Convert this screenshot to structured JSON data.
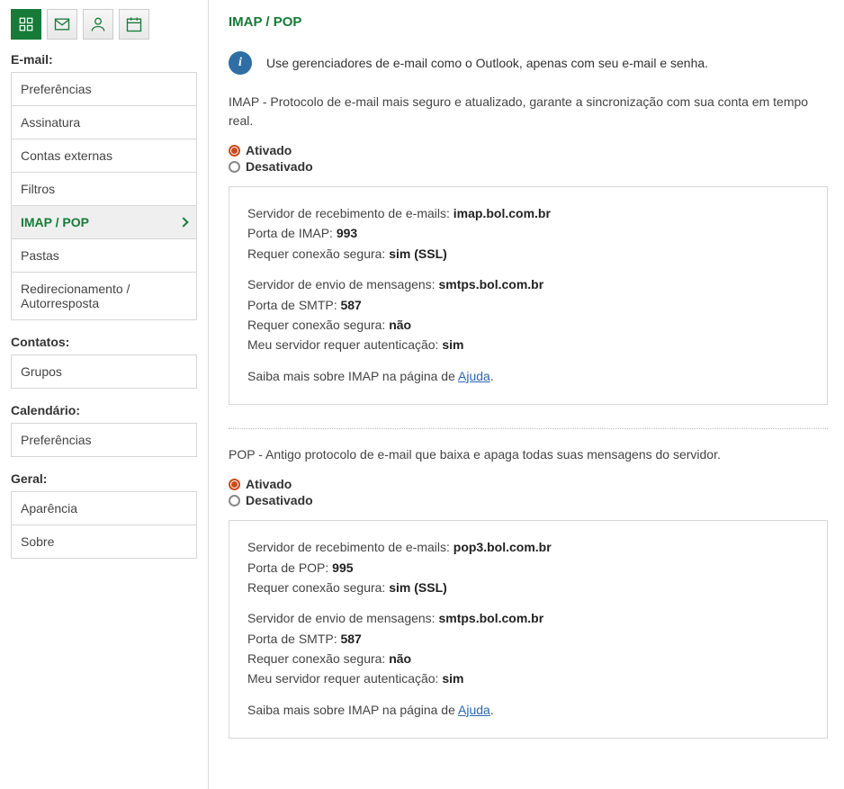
{
  "sidebar": {
    "sections": [
      {
        "title": "E-mail:",
        "items": [
          {
            "label": "Preferências",
            "selected": false
          },
          {
            "label": "Assinatura",
            "selected": false
          },
          {
            "label": "Contas externas",
            "selected": false
          },
          {
            "label": "Filtros",
            "selected": false
          },
          {
            "label": "IMAP / POP",
            "selected": true
          },
          {
            "label": "Pastas",
            "selected": false
          },
          {
            "label": "Redirecionamento / Autorresposta",
            "selected": false
          }
        ]
      },
      {
        "title": "Contatos:",
        "items": [
          {
            "label": "Grupos",
            "selected": false
          }
        ]
      },
      {
        "title": "Calendário:",
        "items": [
          {
            "label": "Preferências",
            "selected": false
          }
        ]
      },
      {
        "title": "Geral:",
        "items": [
          {
            "label": "Aparência",
            "selected": false
          },
          {
            "label": "Sobre",
            "selected": false
          }
        ]
      }
    ]
  },
  "page": {
    "title": "IMAP / POP",
    "info_text": "Use gerenciadores de e-mail como o Outlook, apenas com seu e-mail e senha.",
    "imap": {
      "desc": "IMAP - Protocolo de e-mail mais seguro e atualizado, garante a sincronização com sua conta em tempo real.",
      "option_on": "Ativado",
      "option_off": "Desativado",
      "selected": "on",
      "recv_label": "Servidor de recebimento de e-mails: ",
      "recv_value": "imap.bol.com.br",
      "port_label": "Porta de IMAP: ",
      "port_value": "993",
      "ssl_label": "Requer conexão segura: ",
      "ssl_value": "sim (SSL)",
      "send_label": "Servidor de envio de mensagens: ",
      "send_value": "smtps.bol.com.br",
      "smtp_port_label": "Porta de SMTP: ",
      "smtp_port_value": "587",
      "send_ssl_label": "Requer conexão segura: ",
      "send_ssl_value": "não",
      "auth_label": "Meu servidor requer autenticação: ",
      "auth_value": "sim",
      "help_prefix": "Saiba mais sobre IMAP na página de ",
      "help_link": "Ajuda",
      "help_suffix": "."
    },
    "pop": {
      "desc": "POP - Antigo protocolo de e-mail que baixa e apaga todas suas mensagens do servidor.",
      "option_on": "Ativado",
      "option_off": "Desativado",
      "selected": "on",
      "recv_label": "Servidor de recebimento de e-mails: ",
      "recv_value": "pop3.bol.com.br",
      "port_label": "Porta de POP: ",
      "port_value": "995",
      "ssl_label": "Requer conexão segura: ",
      "ssl_value": "sim (SSL)",
      "send_label": "Servidor de envio de mensagens: ",
      "send_value": "smtps.bol.com.br",
      "smtp_port_label": "Porta de SMTP: ",
      "smtp_port_value": "587",
      "send_ssl_label": "Requer conexão segura: ",
      "send_ssl_value": "não",
      "auth_label": "Meu servidor requer autenticação: ",
      "auth_value": "sim",
      "help_prefix": "Saiba mais sobre IMAP na página de ",
      "help_link": "Ajuda",
      "help_suffix": "."
    }
  }
}
